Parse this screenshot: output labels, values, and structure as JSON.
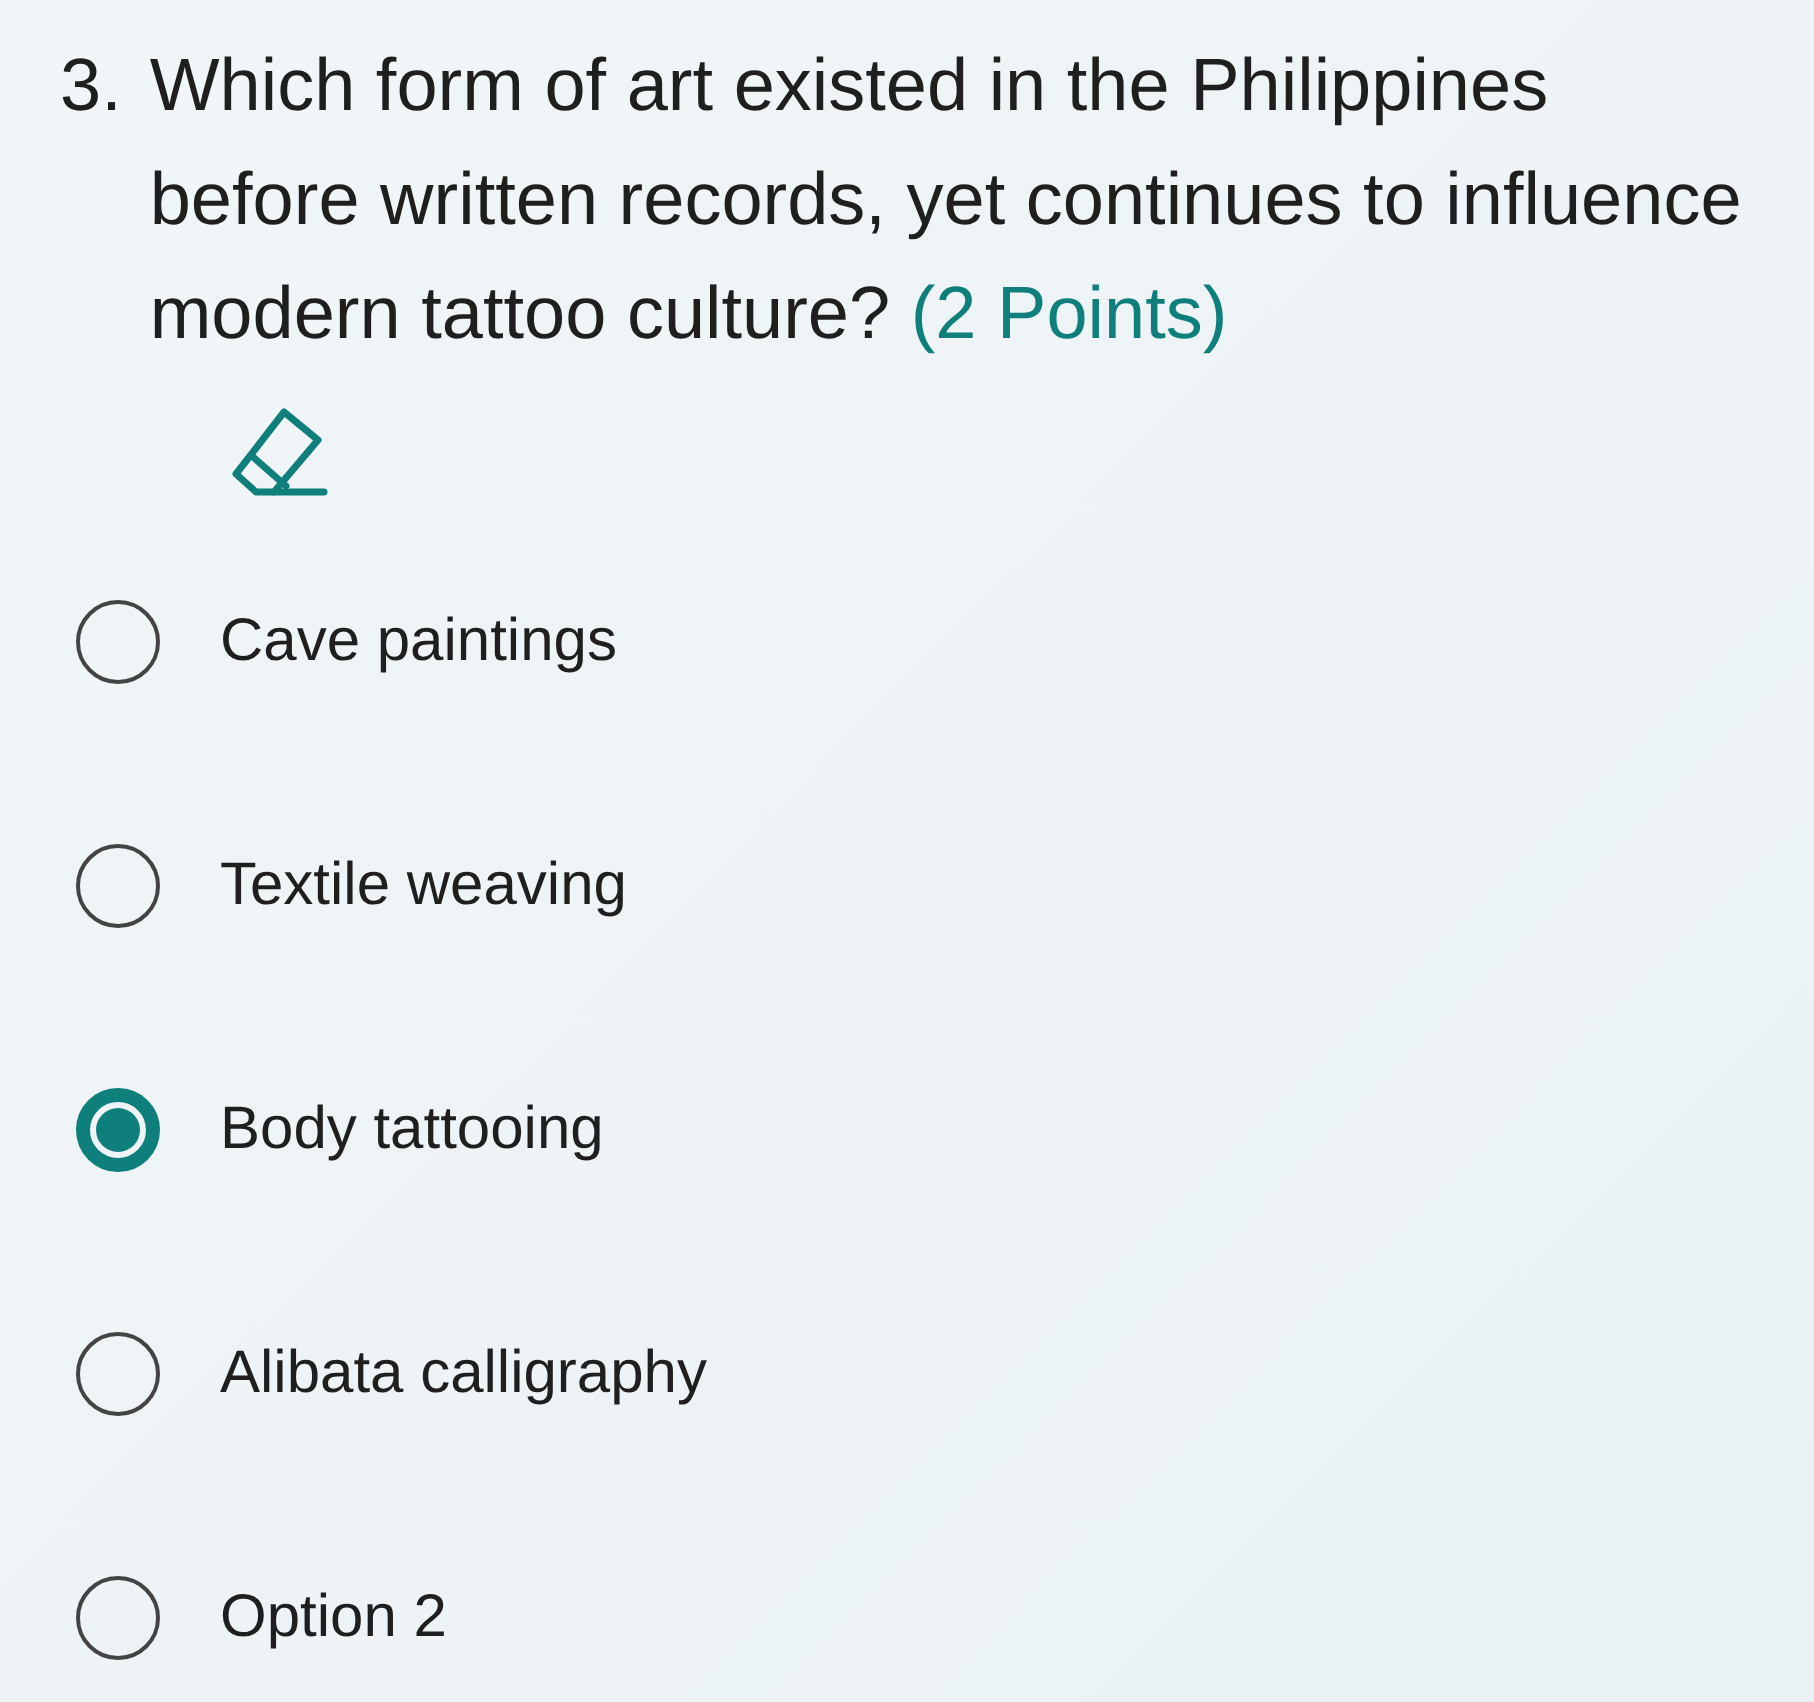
{
  "question": {
    "number": "3.",
    "text": "Which form of art existed in the Philippines before written records, yet continues to influence modern tattoo culture?",
    "points": "(2 Points)"
  },
  "options": [
    {
      "label": "Cave paintings",
      "selected": false
    },
    {
      "label": "Textile weaving",
      "selected": false
    },
    {
      "label": "Body tattooing",
      "selected": true
    },
    {
      "label": "Alibata calligraphy",
      "selected": false
    },
    {
      "label": "Option 2",
      "selected": false
    }
  ]
}
